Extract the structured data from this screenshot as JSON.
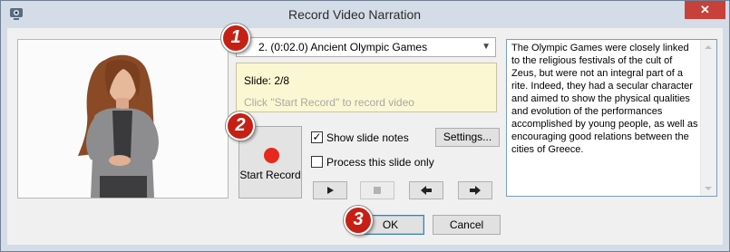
{
  "window": {
    "title": "Record Video Narration",
    "close_symbol": "✕"
  },
  "slide_select": {
    "value": "2. (0:02.0) Ancient Olympic Games"
  },
  "info": {
    "slide_label": "Slide: 2/8",
    "hint": "Click \"Start Record\" to record video"
  },
  "record": {
    "label": "Start Record"
  },
  "options": {
    "show_slide_notes": {
      "label": "Show slide notes",
      "checked": true,
      "mark": "✓"
    },
    "process_this_slide_only": {
      "label": "Process this slide only",
      "checked": false
    }
  },
  "buttons": {
    "settings": "Settings...",
    "ok": "OK",
    "cancel": "Cancel"
  },
  "media_controls": [
    "play-icon",
    "stop-icon",
    "previous-arrow-icon",
    "next-arrow-icon"
  ],
  "notes": {
    "text": "The Olympic Games were closely linked to the religious festivals of the cult of Zeus, but were not an integral part of a rite. Indeed, they had a secular character and aimed to show the physical qualities and evolution of the performances accomplished by young people, as well as encouraging good relations between the cities of Greece."
  },
  "callouts": [
    "1",
    "2",
    "3"
  ],
  "colors": {
    "record_dot": "#e8271d",
    "close_button": "#c7413a",
    "callout": "#c62015",
    "info_box": "#fbf7d2"
  }
}
